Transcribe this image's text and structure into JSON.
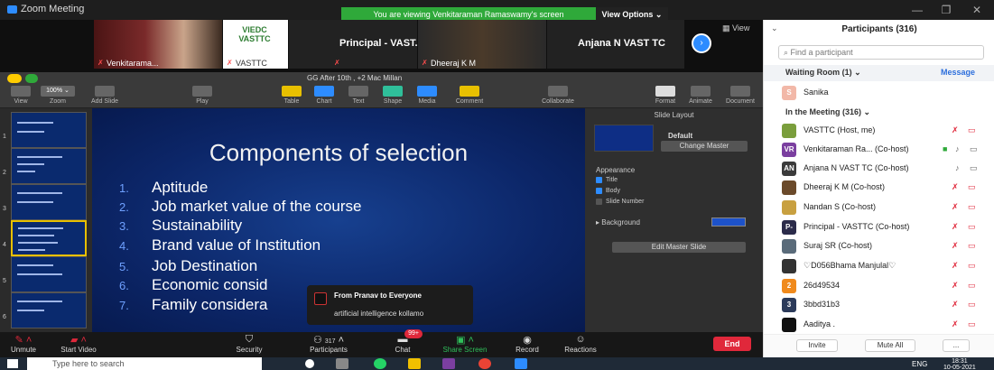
{
  "window": {
    "app_title": "Zoom Meeting",
    "viewing_banner": "You are viewing Venkitaraman Ramaswamy's screen",
    "view_options": "View Options ⌄"
  },
  "videos": {
    "tiles": [
      {
        "name": "Venkitarama..."
      },
      {
        "name": "VASTTC",
        "logo_text": "VIEDC VASTTC"
      },
      {
        "name": "Principal - VAST...",
        "text_only": true
      },
      {
        "name": "Dheeraj K M"
      },
      {
        "name": "Anjana N VAST TC",
        "text_only": true
      }
    ],
    "view_label": "View"
  },
  "keynote": {
    "doc_title": "GG After 10th , +2  Mac Millan",
    "tools": [
      {
        "label": "View"
      },
      {
        "label": "Zoom",
        "value": "100% ⌄"
      },
      {
        "label": "Add Slide"
      },
      {
        "label": "Play"
      },
      {
        "label": "Table"
      },
      {
        "label": "Chart"
      },
      {
        "label": "Text"
      },
      {
        "label": "Shape"
      },
      {
        "label": "Media"
      },
      {
        "label": "Comment"
      },
      {
        "label": "Collaborate"
      },
      {
        "label": "Format"
      },
      {
        "label": "Animate"
      },
      {
        "label": "Document"
      }
    ]
  },
  "slide_nav": {
    "numbers": [
      "1",
      "2",
      "3",
      "4",
      "5",
      "6"
    ]
  },
  "slide": {
    "title": "Components of selection",
    "bullets": [
      {
        "num": "1.",
        "text": "Aptitude"
      },
      {
        "num": "2.",
        "text": "Job market value of the course"
      },
      {
        "num": "3.",
        "text": "Sustainability"
      },
      {
        "num": "4.",
        "text": "Brand  value of Institution"
      },
      {
        "num": "5.",
        "text": "Job Destination"
      },
      {
        "num": "6.",
        "text": "Economic consid"
      },
      {
        "num": "7.",
        "text": "Family considera"
      }
    ]
  },
  "chat_popup": {
    "from": "From Pranav to Everyone",
    "message": "artificial intelligence kollamo"
  },
  "format_panel": {
    "header": "Slide Layout",
    "layout_name": "Default",
    "change_master": "Change Master",
    "appearance": "Appearance",
    "checks": [
      {
        "label": "Title",
        "on": true
      },
      {
        "label": "Body",
        "on": true
      },
      {
        "label": "Slide Number",
        "on": false
      }
    ],
    "background": "Background",
    "edit_master": "Edit Master Slide"
  },
  "zoom_toolbar": {
    "unmute": "Unmute",
    "start_video": "Start Video",
    "security": "Security",
    "participants": "Participants",
    "participant_count": "317",
    "chat": "Chat",
    "chat_badge": "99+",
    "share_screen": "Share Screen",
    "record": "Record",
    "reactions": "Reactions",
    "end": "End"
  },
  "participants": {
    "title": "Participants (316)",
    "search_placeholder": "Find a participant",
    "waiting_room": "Waiting Room (1)  ⌄",
    "message": "Message",
    "waiting": [
      {
        "initial": "S",
        "name": "Sanika",
        "color": "#f2b8a8"
      }
    ],
    "in_meeting": "In the Meeting (316)  ⌄",
    "list": [
      {
        "initial": "",
        "name": "VASTTC (Host, me)",
        "color": "#7a9e3c"
      },
      {
        "initial": "VR",
        "name": "Venkitaraman Ra...  (Co-host)",
        "color": "#7b3fa0"
      },
      {
        "initial": "AN",
        "name": "Anjana N VAST TC (Co-host)",
        "color": "#3b3b3b"
      },
      {
        "initial": "",
        "name": "Dheeraj K M (Co-host)",
        "color": "#6b4a2a"
      },
      {
        "initial": "",
        "name": "Nandan S (Co-host)",
        "color": "#c8a040"
      },
      {
        "initial": "P-",
        "name": "Principal - VASTTC (Co-host)",
        "color": "#2b2b4a"
      },
      {
        "initial": "",
        "name": "Suraj SR (Co-host)",
        "color": "#5a6b7a"
      },
      {
        "initial": "",
        "name": "♡D056Bhama Manjulal♡",
        "color": "#333"
      },
      {
        "initial": "2",
        "name": "26d49534",
        "color": "#f08a1c"
      },
      {
        "initial": "3",
        "name": "3bbd31b3",
        "color": "#2b3a5a"
      },
      {
        "initial": "",
        "name": "Aaditya .",
        "color": "#111"
      }
    ],
    "invite": "Invite",
    "mute_all": "Mute All",
    "more": "..."
  },
  "taskbar": {
    "search_placeholder": "Type here to search",
    "lang": "ENG",
    "time": "18:31",
    "date": "10-05-2021"
  },
  "colors": {
    "accent": "#2d8cff",
    "end_red": "#e0283b",
    "banner_green": "#2fa93a",
    "slide_blue": "#0d2a6b"
  }
}
